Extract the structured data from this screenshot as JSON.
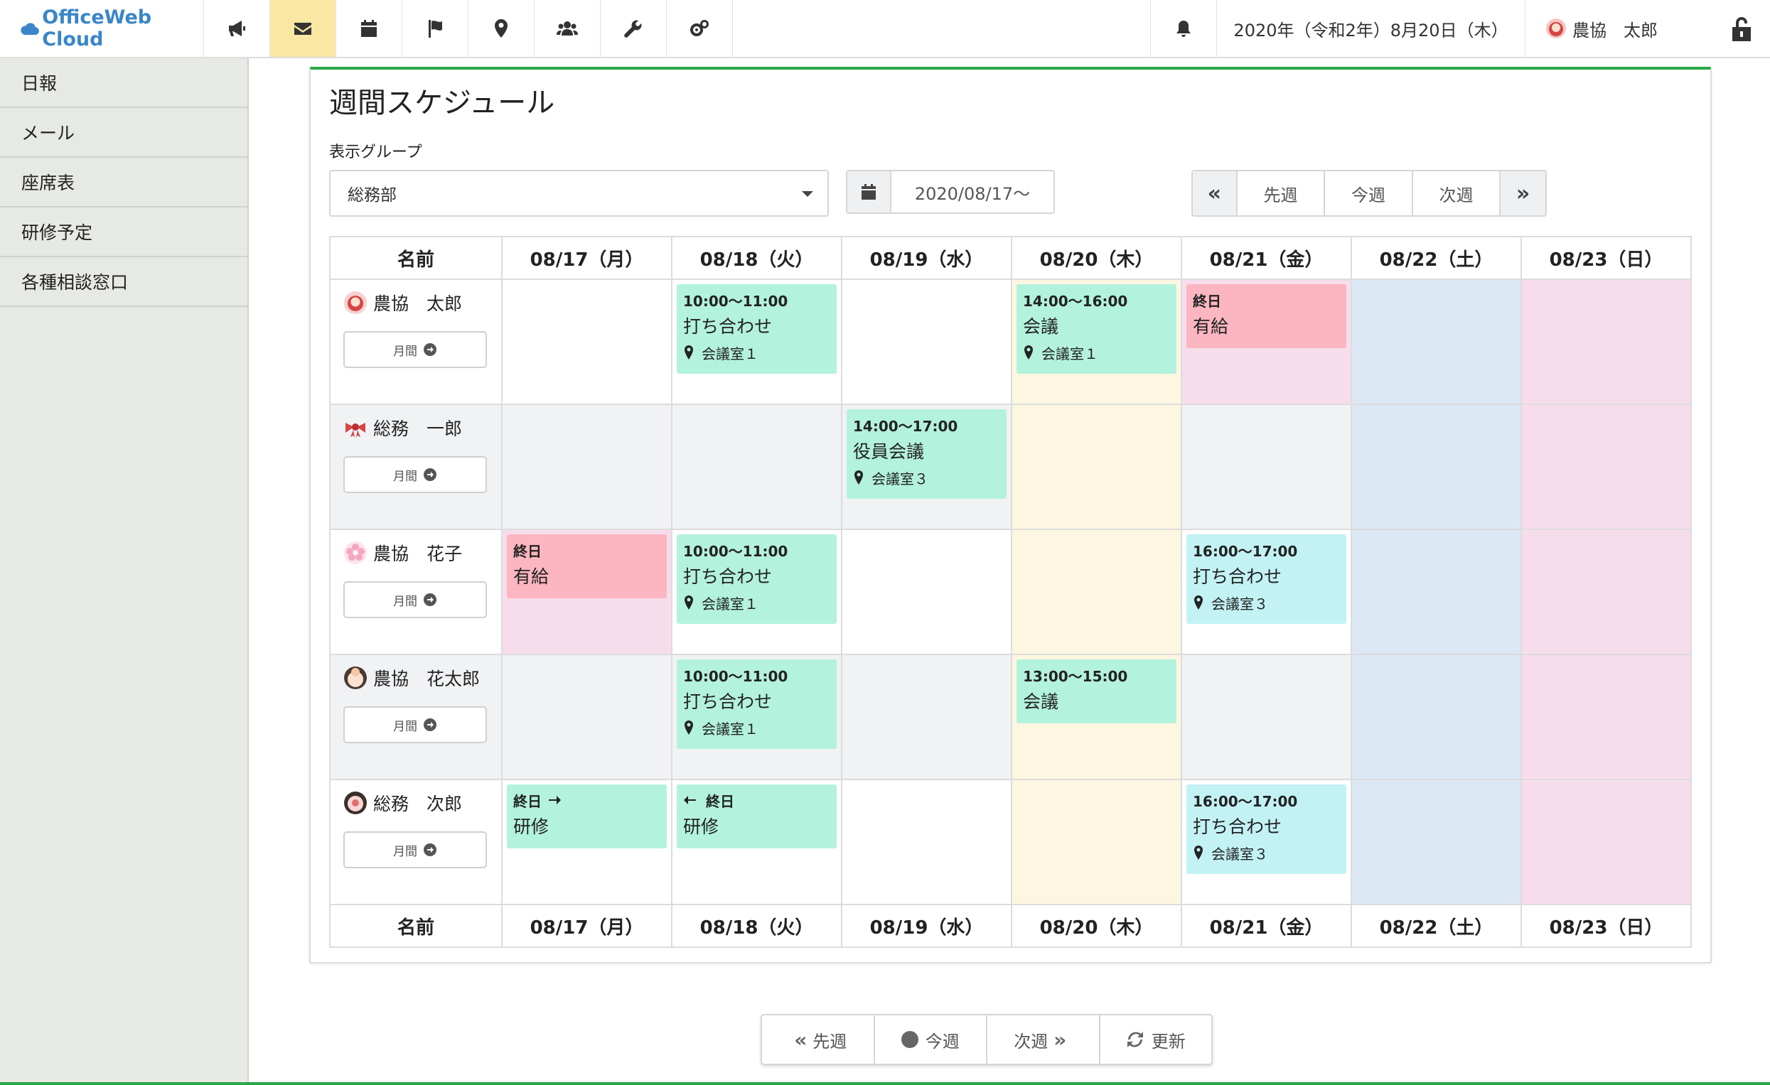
{
  "app": {
    "brand": "OfficeWeb Cloud"
  },
  "topbar": {
    "nav_icons": [
      "megaphone-icon",
      "envelope-icon",
      "calendar-icon",
      "flag-icon",
      "map-marker-icon",
      "users-icon",
      "wrench-icon",
      "gears-icon"
    ],
    "active_icon": "envelope-icon",
    "date": "2020年（令和2年）8月20日（木）",
    "user": "農協　太郎"
  },
  "sidebar": {
    "items": [
      "日報",
      "メール",
      "座席表",
      "研修予定",
      "各種相談窓口"
    ]
  },
  "schedule": {
    "title": "週間スケジュール",
    "group_label": "表示グループ",
    "group_value": "総務部",
    "date_value": "2020/08/17〜",
    "week_prev": "先週",
    "week_current": "今週",
    "week_next": "次週",
    "name_header": "名前",
    "days": [
      "08/17（月）",
      "08/18（火）",
      "08/19（水）",
      "08/20（木）",
      "08/21（金）",
      "08/22（土）",
      "08/23（日）"
    ],
    "month_button": "月間",
    "people": [
      {
        "name": "農協　太郎",
        "events": [
          {
            "time": "10:00〜11:00",
            "title": "打ち合わせ",
            "place": "会議室１"
          },
          {
            "time": "14:00〜16:00",
            "title": "会議",
            "place": "会議室１"
          },
          {
            "time": "終日",
            "title": "有給"
          }
        ]
      },
      {
        "name": "総務　一郎",
        "events": [
          {
            "time": "14:00〜17:00",
            "title": "役員会議",
            "place": "会議室３"
          }
        ]
      },
      {
        "name": "農協　花子",
        "events": [
          {
            "time": "終日",
            "title": "有給"
          },
          {
            "time": "10:00〜11:00",
            "title": "打ち合わせ",
            "place": "会議室１"
          },
          {
            "time": "16:00〜17:00",
            "title": "打ち合わせ",
            "place": "会議室３"
          }
        ]
      },
      {
        "name": "農協　花太郎",
        "events": [
          {
            "time": "10:00〜11:00",
            "title": "打ち合わせ",
            "place": "会議室１"
          },
          {
            "time": "13:00〜15:00",
            "title": "会議"
          }
        ]
      },
      {
        "name": "総務　次郎",
        "events": [
          {
            "time": "終日",
            "title": "研修"
          },
          {
            "time": "終日",
            "title": "研修"
          },
          {
            "time": "16:00〜17:00",
            "title": "打ち合わせ",
            "place": "会議室３"
          }
        ]
      }
    ]
  },
  "bottomnav": {
    "prev": "先週",
    "current": "今週",
    "next": "次週",
    "refresh": "更新"
  },
  "colors": {
    "accent_green": "#29a745",
    "brand_blue": "#3a86c8",
    "active_nav": "#fbe7a4",
    "event_green": "#b3f2dd",
    "event_cyan": "#c3f2f4",
    "event_red": "#fbb6c1"
  }
}
